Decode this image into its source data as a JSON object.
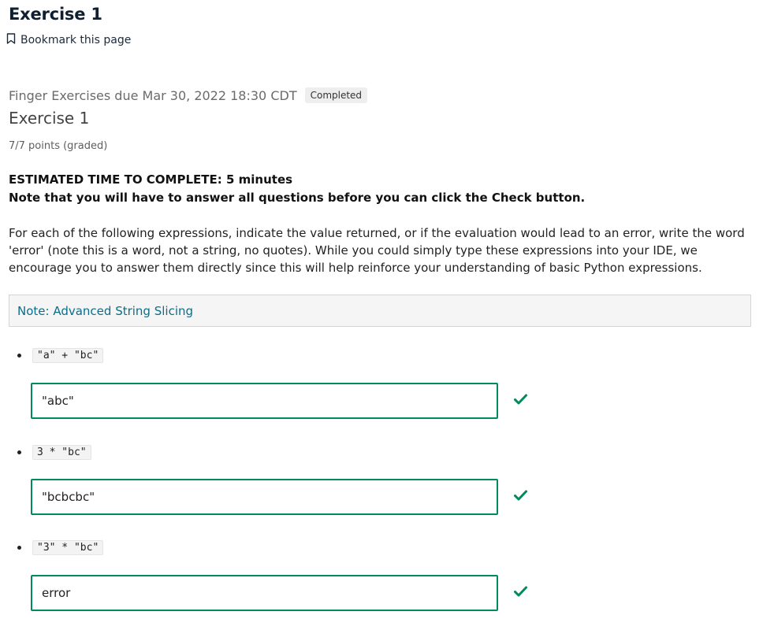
{
  "header": {
    "title": "Exercise 1",
    "bookmark_label": "Bookmark this page"
  },
  "problem": {
    "subsection": "Finger Exercises due Mar 30, 2022 18:30 CDT",
    "status_badge": "Completed",
    "title": "Exercise 1",
    "points": "7/7 points (graded)",
    "estimated_time": "ESTIMATED TIME TO COMPLETE: 5 minutes",
    "note_check": "Note that you will have to answer all questions before you can click the Check button.",
    "description": "For each of the following expressions, indicate the value returned, or if the evaluation would lead to an error, write the word 'error' (note this is a word, not a string, no quotes). While you could simply type these expressions into your IDE, we encourage you to answer them directly since this will help reinforce your understanding of basic Python expressions.",
    "note_link": "Note: Advanced String Slicing"
  },
  "questions": [
    {
      "expression": "\"a\" + \"bc\"",
      "answer": "\"abc\"",
      "status": "correct"
    },
    {
      "expression": "3 * \"bc\"",
      "answer": "\"bcbcbc\"",
      "status": "correct"
    },
    {
      "expression": "\"3\" * \"bc\"",
      "answer": "error",
      "status": "correct"
    }
  ],
  "colors": {
    "correct": "#008a5e",
    "link": "#0a6e8a",
    "title": "#101f30"
  },
  "icons": {
    "bookmark": "bookmark-icon",
    "correct": "checkmark-icon"
  }
}
